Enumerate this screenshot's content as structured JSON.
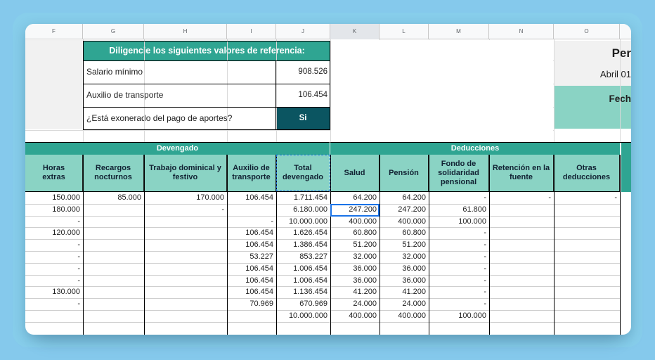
{
  "column_letters": [
    "F",
    "G",
    "H",
    "I",
    "J",
    "K",
    "L",
    "M",
    "N",
    "O"
  ],
  "reference_box": {
    "title": "Diligencie los siguientes valores de referencia:",
    "rows": [
      {
        "label": "Salario mínimo",
        "value": "908.526"
      },
      {
        "label": "Auxilio de transporte",
        "value": "106.454"
      },
      {
        "label": "¿Está exonerado del pago de aportes?",
        "value": "Si"
      }
    ]
  },
  "right_panel": {
    "title_fragment": "Per",
    "date_fragment": "Abril 01",
    "fecha_fragment": "Fech"
  },
  "sections": {
    "devengado": "Devengado",
    "deducciones": "Deducciones"
  },
  "headers": {
    "horas_extras": "Horas extras",
    "recargos_nocturnos": "Recargos nocturnos",
    "trabajo_dominical": "Trabajo dominical y festivo",
    "auxilio_transporte": "Auxilio de transporte",
    "total_devengado": "Total devengado",
    "salud": "Salud",
    "pension": "Pensión",
    "fondo_solidaridad": "Fondo de solidaridad pensional",
    "retencion_fuente": "Retención en la fuente",
    "otras_deducciones": "Otras deducciones"
  },
  "rows": [
    [
      "150.000",
      "85.000",
      "170.000",
      "106.454",
      "1.711.454",
      "64.200",
      "64.200",
      "-",
      "-",
      "-"
    ],
    [
      "180.000",
      "",
      "-",
      "",
      "6.180.000",
      "247.200",
      "247.200",
      "61.800",
      "",
      ""
    ],
    [
      "-",
      "",
      "",
      "-",
      "10.000.000",
      "400.000",
      "400.000",
      "100.000",
      "",
      ""
    ],
    [
      "120.000",
      "",
      "",
      "106.454",
      "1.626.454",
      "60.800",
      "60.800",
      "-",
      "",
      ""
    ],
    [
      "-",
      "",
      "",
      "106.454",
      "1.386.454",
      "51.200",
      "51.200",
      "-",
      "",
      ""
    ],
    [
      "-",
      "",
      "",
      "53.227",
      "853.227",
      "32.000",
      "32.000",
      "-",
      "",
      ""
    ],
    [
      "-",
      "",
      "",
      "106.454",
      "1.006.454",
      "36.000",
      "36.000",
      "-",
      "",
      ""
    ],
    [
      "-",
      "",
      "",
      "106.454",
      "1.006.454",
      "36.000",
      "36.000",
      "-",
      "",
      ""
    ],
    [
      "130.000",
      "",
      "",
      "106.454",
      "1.136.454",
      "41.200",
      "41.200",
      "-",
      "",
      ""
    ],
    [
      "-",
      "",
      "",
      "70.969",
      "670.969",
      "24.000",
      "24.000",
      "-",
      "",
      ""
    ],
    [
      "",
      "",
      "",
      "",
      "10.000.000",
      "400.000",
      "400.000",
      "100.000",
      "",
      ""
    ]
  ],
  "colors": {
    "dark_teal": "#2fa592",
    "light_teal": "#8ad3c4",
    "selected_cell_bg": "#0b5561",
    "background": "#85c9ec"
  }
}
